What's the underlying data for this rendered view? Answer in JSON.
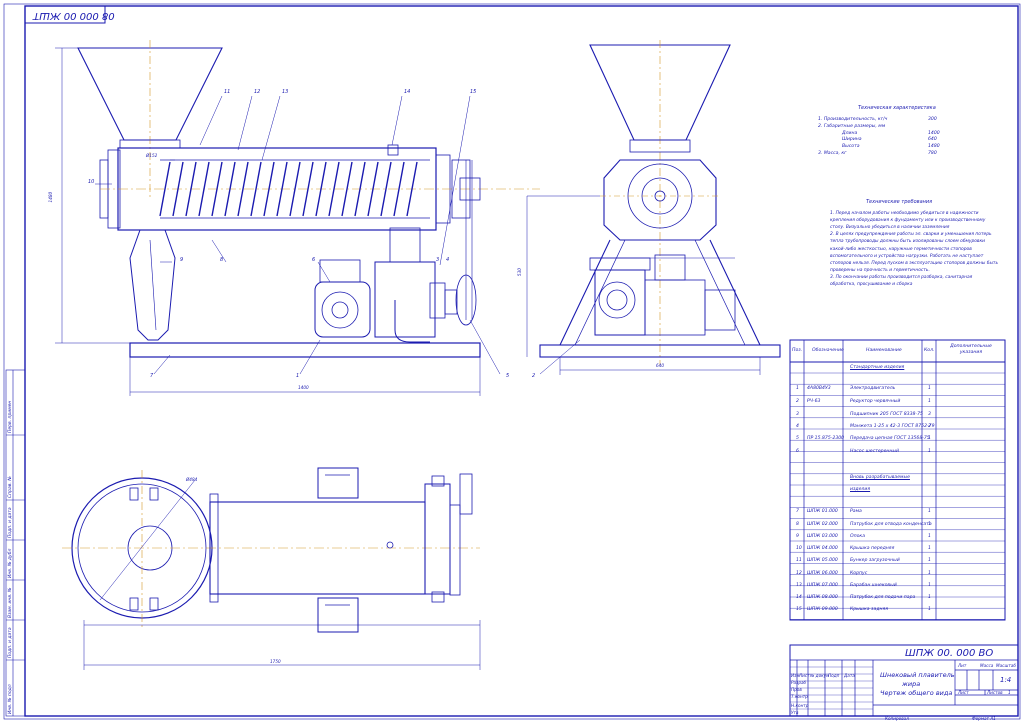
{
  "drawing_number_stamp": "08 000 00 ЖШТ",
  "leader_numbers": [
    "1",
    "2",
    "3",
    "4",
    "5",
    "6",
    "7",
    "8",
    "9",
    "10",
    "11",
    "12",
    "13",
    "14",
    "15"
  ],
  "dimensions": {
    "height_main": "1480",
    "length_main": "1400",
    "length_plan": "1750",
    "width_side": "640",
    "height_side": "530",
    "diam_plan": "Ø484",
    "diam_screw": "Ø152"
  },
  "tech_char": {
    "title": "Техническая характеристика",
    "lines": [
      {
        "text": "1. Производительность, кг/ч",
        "value": "300"
      },
      {
        "text": "2. Габаритные размеры, мм",
        "value": ""
      },
      {
        "text": "Длина",
        "value": "1400"
      },
      {
        "text": "Ширина",
        "value": "640"
      },
      {
        "text": "Высота",
        "value": "1480"
      },
      {
        "text": "3. Масса, кг",
        "value": "780"
      }
    ]
  },
  "tech_req": {
    "title": "Технические требования",
    "lines": [
      "1. Перед началом работы необходимо убедиться в надежности",
      "крепления оборудования к фундаменту или к производственному",
      "столу. Визуально убедиться в наличии заземления",
      "2. В целях предупреждения работы эл. сварки и уменьшения потерь",
      "тепла трубопроводы должны быть изолированы слоем обмуровки",
      "какой-либо жесткостью, наружные герметичности стопоров",
      "вспомогательного и устройства нагрузки. Работать не наступает",
      "стопоров нельзя. Перед пуском в эксплуатацию стопоров должны быть",
      "проверены на прочность и герметичность.",
      "3. По окончании работы производится разборка, санитарная",
      "обработка, просушивание и сборка"
    ]
  },
  "spec": {
    "headers": [
      "Поз.",
      "Обозначение",
      "Наименование",
      "Кол.",
      "Дополнительные указания"
    ],
    "section1": "Стандартные изделия",
    "section2a": "Вновь разрабатываемые",
    "section2b": "изделия",
    "rows": [
      {
        "pos": "1",
        "code": "4А80В4У3",
        "name": "Электродвигатель",
        "qty": "1"
      },
      {
        "pos": "2",
        "code": "РЧ-63",
        "name": "Редуктор червячный",
        "qty": "1"
      },
      {
        "pos": "3",
        "code": "",
        "name": "Подшипник 205 ГОСТ 8338-75",
        "qty": "3"
      },
      {
        "pos": "4",
        "code": "",
        "name": "Манжета 1-25 х 42-3 ГОСТ 8752-79",
        "qty": "2"
      },
      {
        "pos": "5",
        "code": "ПР 15.875-2300",
        "name": "Передача цепная ГОСТ 13568-75",
        "qty": "1"
      },
      {
        "pos": "6",
        "code": "",
        "name": "Насос шестеренный",
        "qty": "1"
      },
      {
        "pos": "7",
        "code": "ШПЖ 01.000",
        "name": "Рама",
        "qty": "1"
      },
      {
        "pos": "8",
        "code": "ШПЖ 02.000",
        "name": "Патрубок для отвода конденсата",
        "qty": "1"
      },
      {
        "pos": "9",
        "code": "ШПЖ 03.000",
        "name": "Опока",
        "qty": "1"
      },
      {
        "pos": "10",
        "code": "ШПЖ 04.000",
        "name": "Крышка передняя",
        "qty": "1"
      },
      {
        "pos": "11",
        "code": "ШПЖ 05.000",
        "name": "Бункер загрузочный",
        "qty": "1"
      },
      {
        "pos": "12",
        "code": "ШПЖ 06.000",
        "name": "Корпус",
        "qty": "1"
      },
      {
        "pos": "13",
        "code": "ШПЖ 07.000",
        "name": "Барабан шнековый",
        "qty": "1"
      },
      {
        "pos": "14",
        "code": "ШПЖ 08.000",
        "name": "Патрубок для подачи пара",
        "qty": "1"
      },
      {
        "pos": "15",
        "code": "ШПЖ 09.000",
        "name": "Крышка задняя",
        "qty": "1"
      }
    ]
  },
  "title_block": {
    "doc_code": "ШПЖ 00. 000 ВО",
    "name_line1": "Шнековый плавитель",
    "name_line2": "жира",
    "name_line3": "Чертеж общего вида",
    "lit_label": "Лит",
    "mass_label": "Масса",
    "scale_label": "Масштаб",
    "scale_value": "1:4",
    "sheet_label": "Лист",
    "sheets_label": "Листов",
    "sheets_value": "1",
    "izm": "Изм",
    "list": "Лист",
    "ndoc": "№ докум",
    "podp": "Подп",
    "data": "Дата",
    "razrab": "Разраб",
    "prov": "Пров",
    "tkontr": "Т.контр",
    "nkontr": "Н.контр",
    "utv": "Утв",
    "copied": "Копировал",
    "format": "Формат А1"
  },
  "left_strip": [
    "Перв. примен",
    "Справ. №",
    "Подп. и дата",
    "Инв. № дубл",
    "Взам. инв. №",
    "Подп. и дата",
    "Инв. № подл"
  ]
}
